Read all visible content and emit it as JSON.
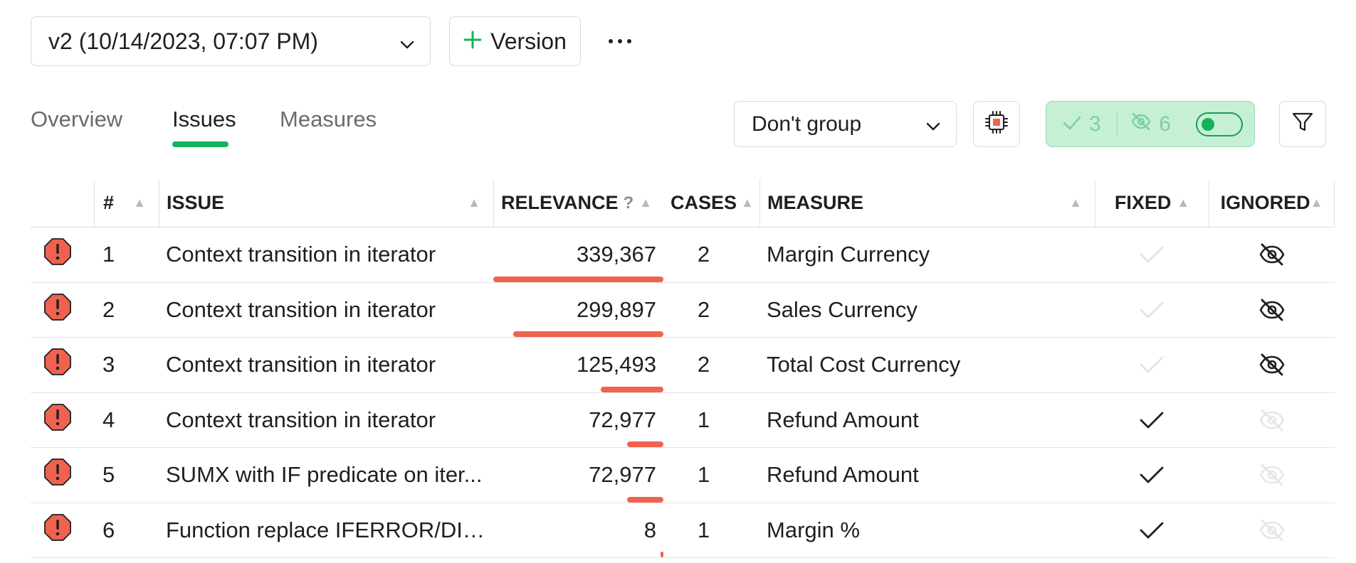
{
  "version_select": {
    "value": "v2 (10/14/2023, 07:07 PM)"
  },
  "version_button": {
    "label": "Version"
  },
  "tabs": [
    {
      "label": "Overview",
      "active": false
    },
    {
      "label": "Issues",
      "active": true
    },
    {
      "label": "Measures",
      "active": false
    }
  ],
  "group_select": {
    "value": "Don't group"
  },
  "status_pill": {
    "fixed_count": "3",
    "ignored_count": "6",
    "toggle_on": true
  },
  "colors": {
    "accent": "#13b35c",
    "danger": "#f06250",
    "pill_bg": "#c6f0d6"
  },
  "table": {
    "headers": {
      "num": "#",
      "issue": "ISSUE",
      "relevance": "RELEVANCE",
      "relevance_help": "?",
      "cases": "CASES",
      "measure": "MEASURE",
      "fixed": "FIXED",
      "ignored": "IGNORED"
    },
    "relevance_max": 339367,
    "rows": [
      {
        "num": "1",
        "issue": "Context transition in iterator",
        "relevance": "339,367",
        "relevance_value": 339367,
        "cases": "2",
        "measure": "Margin Currency",
        "fixed": false,
        "ignored": true
      },
      {
        "num": "2",
        "issue": "Context transition in iterator",
        "relevance": "299,897",
        "relevance_value": 299897,
        "cases": "2",
        "measure": "Sales Currency",
        "fixed": false,
        "ignored": true
      },
      {
        "num": "3",
        "issue": "Context transition in iterator",
        "relevance": "125,493",
        "relevance_value": 125493,
        "cases": "2",
        "measure": "Total Cost Currency",
        "fixed": false,
        "ignored": true
      },
      {
        "num": "4",
        "issue": "Context transition in iterator",
        "relevance": "72,977",
        "relevance_value": 72977,
        "cases": "1",
        "measure": "Refund Amount",
        "fixed": true,
        "ignored": false
      },
      {
        "num": "5",
        "issue": "SUMX with IF predicate on iter...",
        "relevance": "72,977",
        "relevance_value": 72977,
        "cases": "1",
        "measure": "Refund Amount",
        "fixed": true,
        "ignored": false
      },
      {
        "num": "6",
        "issue": "Function replace IFERROR/DIV...",
        "relevance": "8",
        "relevance_value": 8,
        "cases": "1",
        "measure": "Margin %",
        "fixed": true,
        "ignored": false
      }
    ]
  }
}
